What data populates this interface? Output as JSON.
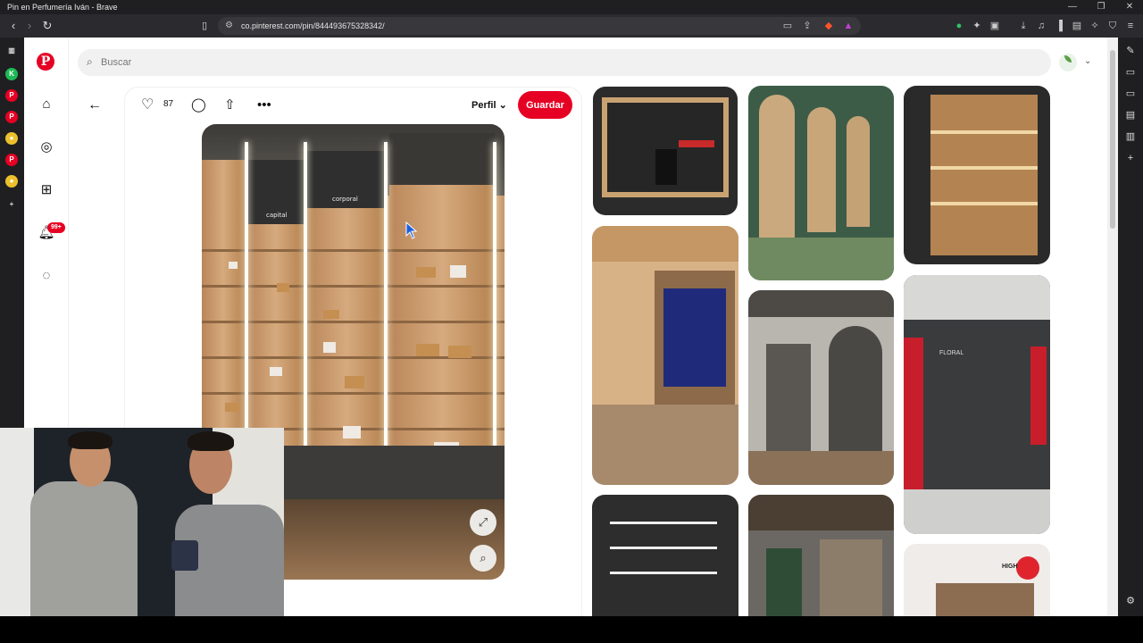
{
  "window": {
    "title": "Pin en Perfumería Iván - Brave",
    "controls": [
      "—",
      "❐",
      "✕"
    ]
  },
  "browser": {
    "url": "co.pinterest.com/pin/844493675328342/"
  },
  "pinterest": {
    "logo": "P",
    "search_placeholder": "Buscar",
    "notifications_badge": "99+",
    "pin": {
      "likes": "87",
      "board_select": "Perfil",
      "save_button": "Guardar",
      "image_signs": [
        "capital",
        "corporal"
      ]
    },
    "tile_signs": [
      "FLORAL",
      "HIGH"
    ]
  },
  "icons": {
    "home": "home-icon",
    "explore": "compass-icon",
    "create": "plus-square-icon",
    "notifications": "bell-icon",
    "messages": "chat-icon"
  },
  "colors": {
    "brand": "#e60023"
  }
}
